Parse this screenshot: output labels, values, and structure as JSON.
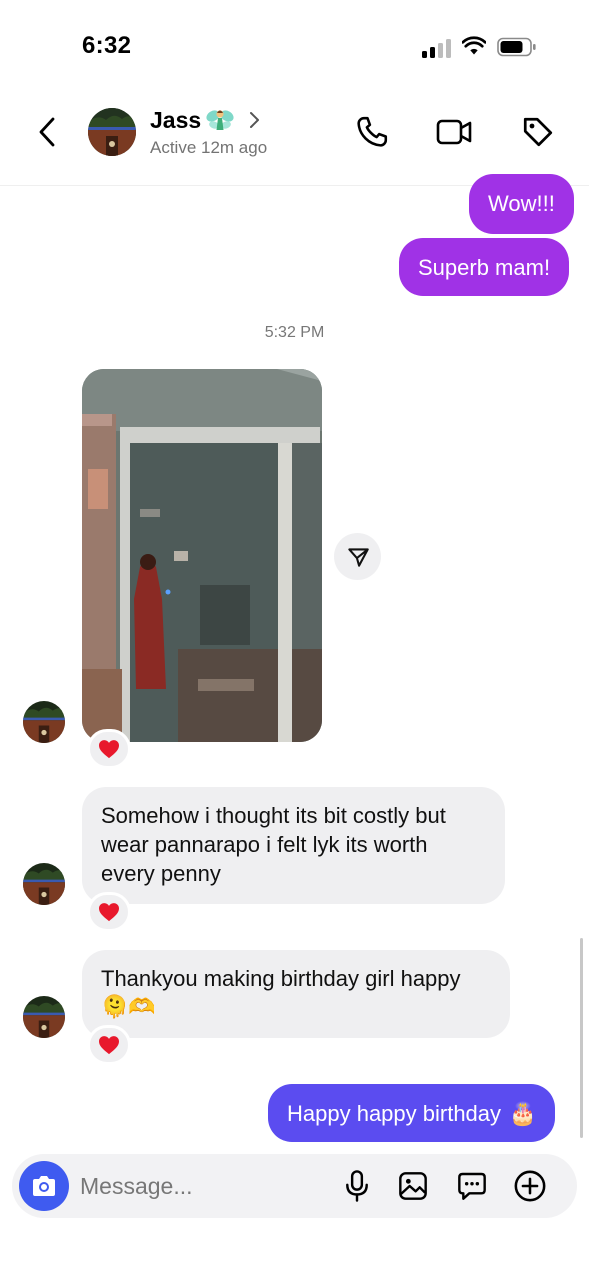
{
  "status_bar": {
    "time": "6:32"
  },
  "header": {
    "contact_name": "Jass",
    "contact_status": "Active 12m ago"
  },
  "messages": {
    "outgoing_1": "Wow!!!",
    "outgoing_2": "Superb mam!",
    "timestamp": "5:32 PM",
    "incoming_1": "Somehow i thought its bit costly but wear pannarapo i felt lyk its worth every penny",
    "incoming_2": "Thankyou making birthday girl happy",
    "incoming_2_emojis": "🫠🫶",
    "outgoing_3": "Happy happy birthday",
    "outgoing_3_emoji": "🎂",
    "reaction": "❤️"
  },
  "composer": {
    "placeholder": "Message..."
  },
  "colors": {
    "outgoing_bubble": "#a032e6",
    "incoming_bubble": "#efeff1",
    "outgoing_latest": "#5b4cf0",
    "camera_button": "#3f5bf0",
    "reaction_heart": "#e8182c"
  },
  "icons": [
    "back-arrow-icon",
    "fairy-icon",
    "chevron-right-icon",
    "phone-icon",
    "video-camera-icon",
    "tag-icon",
    "share-icon",
    "heart-icon",
    "camera-icon",
    "microphone-icon",
    "gallery-icon",
    "sticker-chat-icon",
    "plus-circle-icon"
  ]
}
